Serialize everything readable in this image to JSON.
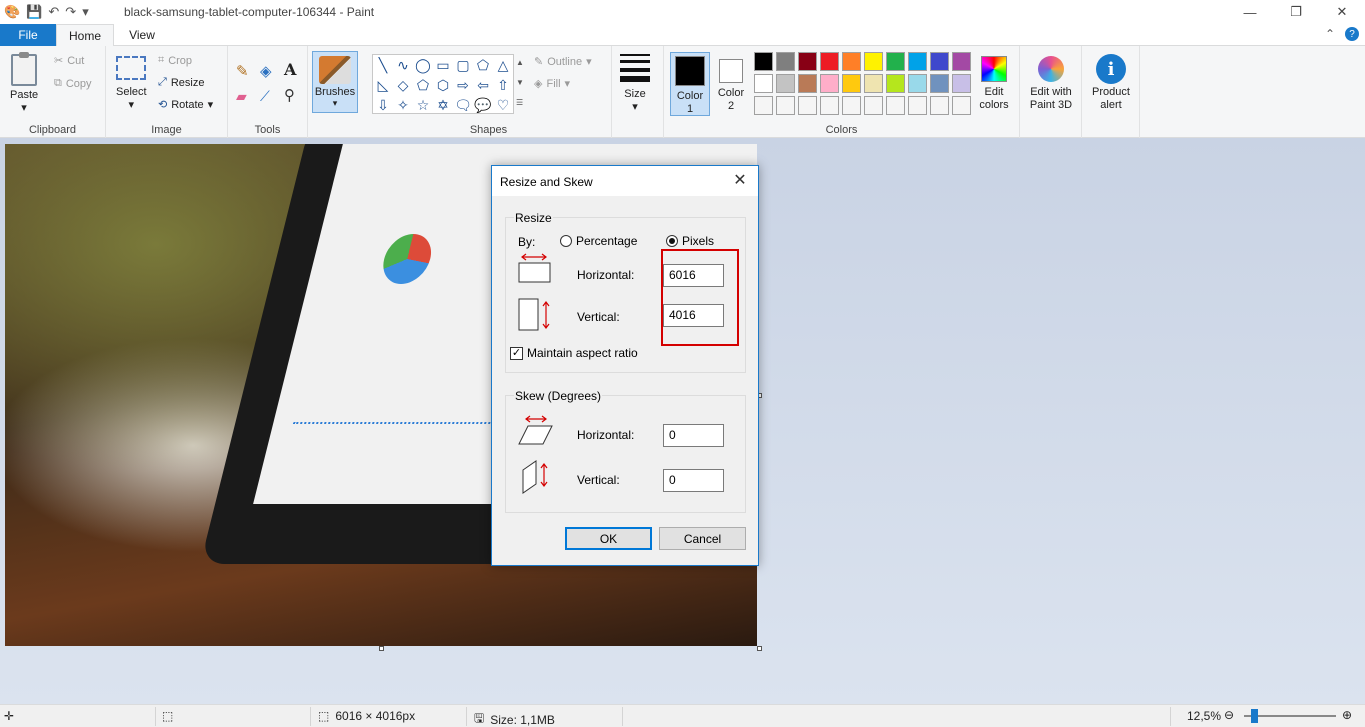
{
  "window": {
    "title": "black-samsung-tablet-computer-106344 - Paint"
  },
  "tabs": {
    "file": "File",
    "home": "Home",
    "view": "View"
  },
  "ribbon": {
    "clipboard": {
      "label": "Clipboard",
      "paste": "Paste",
      "cut": "Cut",
      "copy": "Copy"
    },
    "image": {
      "label": "Image",
      "select": "Select",
      "crop": "Crop",
      "resize": "Resize",
      "rotate": "Rotate"
    },
    "tools": {
      "label": "Tools"
    },
    "brushes": {
      "label": "Brushes"
    },
    "shapes": {
      "label": "Shapes",
      "outline": "Outline",
      "fill": "Fill"
    },
    "size": {
      "label": "Size"
    },
    "colors": {
      "label": "Colors",
      "color1": "Color",
      "color1_num": "1",
      "color2": "Color",
      "color2_num": "2",
      "edit_colors_1": "Edit",
      "edit_colors_2": "colors",
      "palette": [
        "#000000",
        "#7f7f7f",
        "#880015",
        "#ed1c24",
        "#ff7f27",
        "#fff200",
        "#22b14c",
        "#00a2e8",
        "#3f48cc",
        "#a349a4",
        "#ffffff",
        "#c3c3c3",
        "#b97a57",
        "#ffaec9",
        "#ffc90e",
        "#efe4b0",
        "#b5e61d",
        "#99d9ea",
        "#7092be",
        "#c8bfe7",
        "#f5f5f5",
        "#f5f5f5",
        "#f5f5f5",
        "#f5f5f5",
        "#f5f5f5",
        "#f5f5f5",
        "#f5f5f5",
        "#f5f5f5",
        "#f5f5f5",
        "#f5f5f5"
      ],
      "primary": "#000000",
      "secondary": "#ffffff"
    },
    "paint3d": {
      "line1": "Edit with",
      "line2": "Paint 3D"
    },
    "alert": {
      "line1": "Product",
      "line2": "alert"
    }
  },
  "dialog": {
    "title": "Resize and Skew",
    "resize": {
      "legend": "Resize",
      "by": "By:",
      "percentage": "Percentage",
      "pixels": "Pixels",
      "horizontal_label": "Horizontal:",
      "horizontal_value": "6016",
      "vertical_label": "Vertical:",
      "vertical_value": "4016",
      "maintain": "Maintain aspect ratio"
    },
    "skew": {
      "legend": "Skew (Degrees)",
      "horizontal_label": "Horizontal:",
      "horizontal_value": "0",
      "vertical_label": "Vertical:",
      "vertical_value": "0"
    },
    "ok": "OK",
    "cancel": "Cancel"
  },
  "statusbar": {
    "dimensions": "6016 × 4016px",
    "size": "Size: 1,1MB",
    "zoom": "12,5%"
  }
}
